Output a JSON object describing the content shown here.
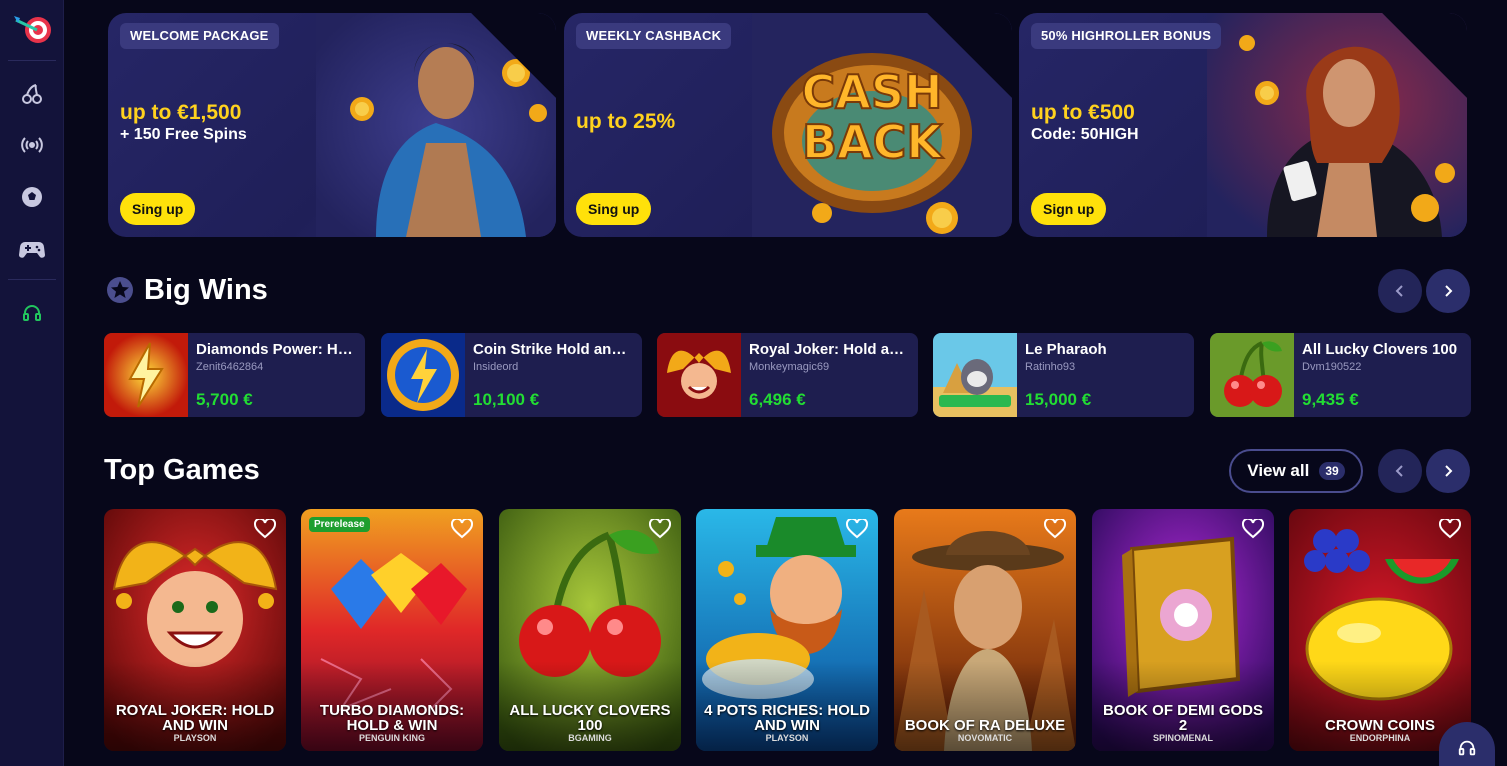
{
  "promos": [
    {
      "badge": "WELCOME PACKAGE",
      "headline": "up to €1,500",
      "subline": "+ 150 Free Spins",
      "button": "Sing up"
    },
    {
      "badge": "WEEKLY CASHBACK",
      "headline": "up to 25%",
      "subline": "",
      "button": "Sing up",
      "art_text_1": "CASH",
      "art_text_2": "BACK"
    },
    {
      "badge": "50% HIGHROLLER BONUS",
      "headline": "up to €500",
      "subline": "Code: 50HIGH",
      "button": "Sign up"
    }
  ],
  "big_wins": {
    "title": "Big Wins",
    "items": [
      {
        "game": "Diamonds Power: Hold and Win",
        "user": "Zenit6462864",
        "amount": "5,700 €"
      },
      {
        "game": "Coin Strike Hold and Win",
        "user": "Insideord",
        "amount": "10,100 €"
      },
      {
        "game": "Royal Joker: Hold and Win",
        "user": "Monkeymagic69",
        "amount": "6,496 €"
      },
      {
        "game": "Le Pharaoh",
        "user": "Ratinho93",
        "amount": "15,000 €"
      },
      {
        "game": "All Lucky Clovers 100",
        "user": "Dvm190522",
        "amount": "9,435 €"
      }
    ]
  },
  "top_games": {
    "title": "Top Games",
    "view_all_label": "View all",
    "view_all_count": "39",
    "items": [
      {
        "title": "Royal Joker: Hold and Win",
        "provider": "Playson",
        "tag": ""
      },
      {
        "title": "Turbo Diamonds: Hold & Win",
        "provider": "Penguin King",
        "tag": "Prerelease"
      },
      {
        "title": "All Lucky Clovers 100",
        "provider": "BGaming",
        "tag": ""
      },
      {
        "title": "4 Pots Riches: Hold and Win",
        "provider": "Playson",
        "tag": ""
      },
      {
        "title": "Book of Ra Deluxe",
        "provider": "Novomatic",
        "tag": ""
      },
      {
        "title": "Book of Demi Gods 2",
        "provider": "Spinomenal",
        "tag": ""
      },
      {
        "title": "Crown Coins",
        "provider": "Endorphina",
        "tag": ""
      }
    ]
  },
  "sidebar": {
    "icons": [
      "cherry-icon",
      "live-broadcast-icon",
      "soccer-ball-icon",
      "gamepad-icon",
      "headset-icon"
    ]
  },
  "colors": {
    "accent_yellow": "#ffe10a",
    "win_green": "#22dd33",
    "panel": "#1e1e4f",
    "sidebar": "#13133a"
  }
}
